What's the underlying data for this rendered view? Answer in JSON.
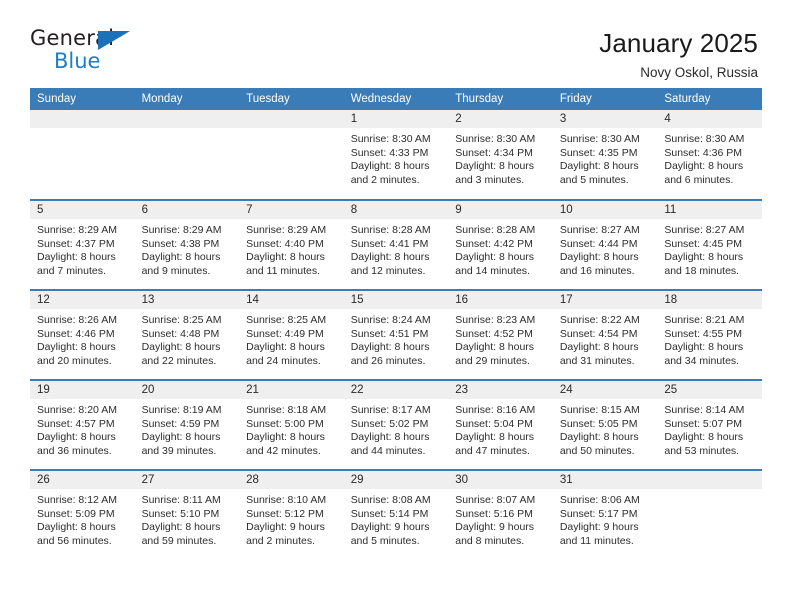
{
  "brand": {
    "logo_text_primary": "General",
    "logo_text_secondary": "Blue",
    "color_primary": "#231f20",
    "color_secondary": "#1f7dc4",
    "triangle_color": "#1c72b8"
  },
  "header": {
    "title": "January 2025",
    "subtitle": "Novy Oskol, Russia"
  },
  "theme": {
    "header_bar_color": "#3a7cb8",
    "date_band_color": "#efefef",
    "row_separator_color": "#3a7cb8",
    "page_background": "#ffffff"
  },
  "calendar": {
    "columns": [
      "Sunday",
      "Monday",
      "Tuesday",
      "Wednesday",
      "Thursday",
      "Friday",
      "Saturday"
    ],
    "weeks": [
      [
        {
          "day": "",
          "text": ""
        },
        {
          "day": "",
          "text": ""
        },
        {
          "day": "",
          "text": ""
        },
        {
          "day": "1",
          "text": "Sunrise: 8:30 AM\nSunset: 4:33 PM\nDaylight: 8 hours\nand 2 minutes."
        },
        {
          "day": "2",
          "text": "Sunrise: 8:30 AM\nSunset: 4:34 PM\nDaylight: 8 hours\nand 3 minutes."
        },
        {
          "day": "3",
          "text": "Sunrise: 8:30 AM\nSunset: 4:35 PM\nDaylight: 8 hours\nand 5 minutes."
        },
        {
          "day": "4",
          "text": "Sunrise: 8:30 AM\nSunset: 4:36 PM\nDaylight: 8 hours\nand 6 minutes."
        }
      ],
      [
        {
          "day": "5",
          "text": "Sunrise: 8:29 AM\nSunset: 4:37 PM\nDaylight: 8 hours\nand 7 minutes."
        },
        {
          "day": "6",
          "text": "Sunrise: 8:29 AM\nSunset: 4:38 PM\nDaylight: 8 hours\nand 9 minutes."
        },
        {
          "day": "7",
          "text": "Sunrise: 8:29 AM\nSunset: 4:40 PM\nDaylight: 8 hours\nand 11 minutes."
        },
        {
          "day": "8",
          "text": "Sunrise: 8:28 AM\nSunset: 4:41 PM\nDaylight: 8 hours\nand 12 minutes."
        },
        {
          "day": "9",
          "text": "Sunrise: 8:28 AM\nSunset: 4:42 PM\nDaylight: 8 hours\nand 14 minutes."
        },
        {
          "day": "10",
          "text": "Sunrise: 8:27 AM\nSunset: 4:44 PM\nDaylight: 8 hours\nand 16 minutes."
        },
        {
          "day": "11",
          "text": "Sunrise: 8:27 AM\nSunset: 4:45 PM\nDaylight: 8 hours\nand 18 minutes."
        }
      ],
      [
        {
          "day": "12",
          "text": "Sunrise: 8:26 AM\nSunset: 4:46 PM\nDaylight: 8 hours\nand 20 minutes."
        },
        {
          "day": "13",
          "text": "Sunrise: 8:25 AM\nSunset: 4:48 PM\nDaylight: 8 hours\nand 22 minutes."
        },
        {
          "day": "14",
          "text": "Sunrise: 8:25 AM\nSunset: 4:49 PM\nDaylight: 8 hours\nand 24 minutes."
        },
        {
          "day": "15",
          "text": "Sunrise: 8:24 AM\nSunset: 4:51 PM\nDaylight: 8 hours\nand 26 minutes."
        },
        {
          "day": "16",
          "text": "Sunrise: 8:23 AM\nSunset: 4:52 PM\nDaylight: 8 hours\nand 29 minutes."
        },
        {
          "day": "17",
          "text": "Sunrise: 8:22 AM\nSunset: 4:54 PM\nDaylight: 8 hours\nand 31 minutes."
        },
        {
          "day": "18",
          "text": "Sunrise: 8:21 AM\nSunset: 4:55 PM\nDaylight: 8 hours\nand 34 minutes."
        }
      ],
      [
        {
          "day": "19",
          "text": "Sunrise: 8:20 AM\nSunset: 4:57 PM\nDaylight: 8 hours\nand 36 minutes."
        },
        {
          "day": "20",
          "text": "Sunrise: 8:19 AM\nSunset: 4:59 PM\nDaylight: 8 hours\nand 39 minutes."
        },
        {
          "day": "21",
          "text": "Sunrise: 8:18 AM\nSunset: 5:00 PM\nDaylight: 8 hours\nand 42 minutes."
        },
        {
          "day": "22",
          "text": "Sunrise: 8:17 AM\nSunset: 5:02 PM\nDaylight: 8 hours\nand 44 minutes."
        },
        {
          "day": "23",
          "text": "Sunrise: 8:16 AM\nSunset: 5:04 PM\nDaylight: 8 hours\nand 47 minutes."
        },
        {
          "day": "24",
          "text": "Sunrise: 8:15 AM\nSunset: 5:05 PM\nDaylight: 8 hours\nand 50 minutes."
        },
        {
          "day": "25",
          "text": "Sunrise: 8:14 AM\nSunset: 5:07 PM\nDaylight: 8 hours\nand 53 minutes."
        }
      ],
      [
        {
          "day": "26",
          "text": "Sunrise: 8:12 AM\nSunset: 5:09 PM\nDaylight: 8 hours\nand 56 minutes."
        },
        {
          "day": "27",
          "text": "Sunrise: 8:11 AM\nSunset: 5:10 PM\nDaylight: 8 hours\nand 59 minutes."
        },
        {
          "day": "28",
          "text": "Sunrise: 8:10 AM\nSunset: 5:12 PM\nDaylight: 9 hours\nand 2 minutes."
        },
        {
          "day": "29",
          "text": "Sunrise: 8:08 AM\nSunset: 5:14 PM\nDaylight: 9 hours\nand 5 minutes."
        },
        {
          "day": "30",
          "text": "Sunrise: 8:07 AM\nSunset: 5:16 PM\nDaylight: 9 hours\nand 8 minutes."
        },
        {
          "day": "31",
          "text": "Sunrise: 8:06 AM\nSunset: 5:17 PM\nDaylight: 9 hours\nand 11 minutes."
        },
        {
          "day": "",
          "text": ""
        }
      ]
    ]
  }
}
